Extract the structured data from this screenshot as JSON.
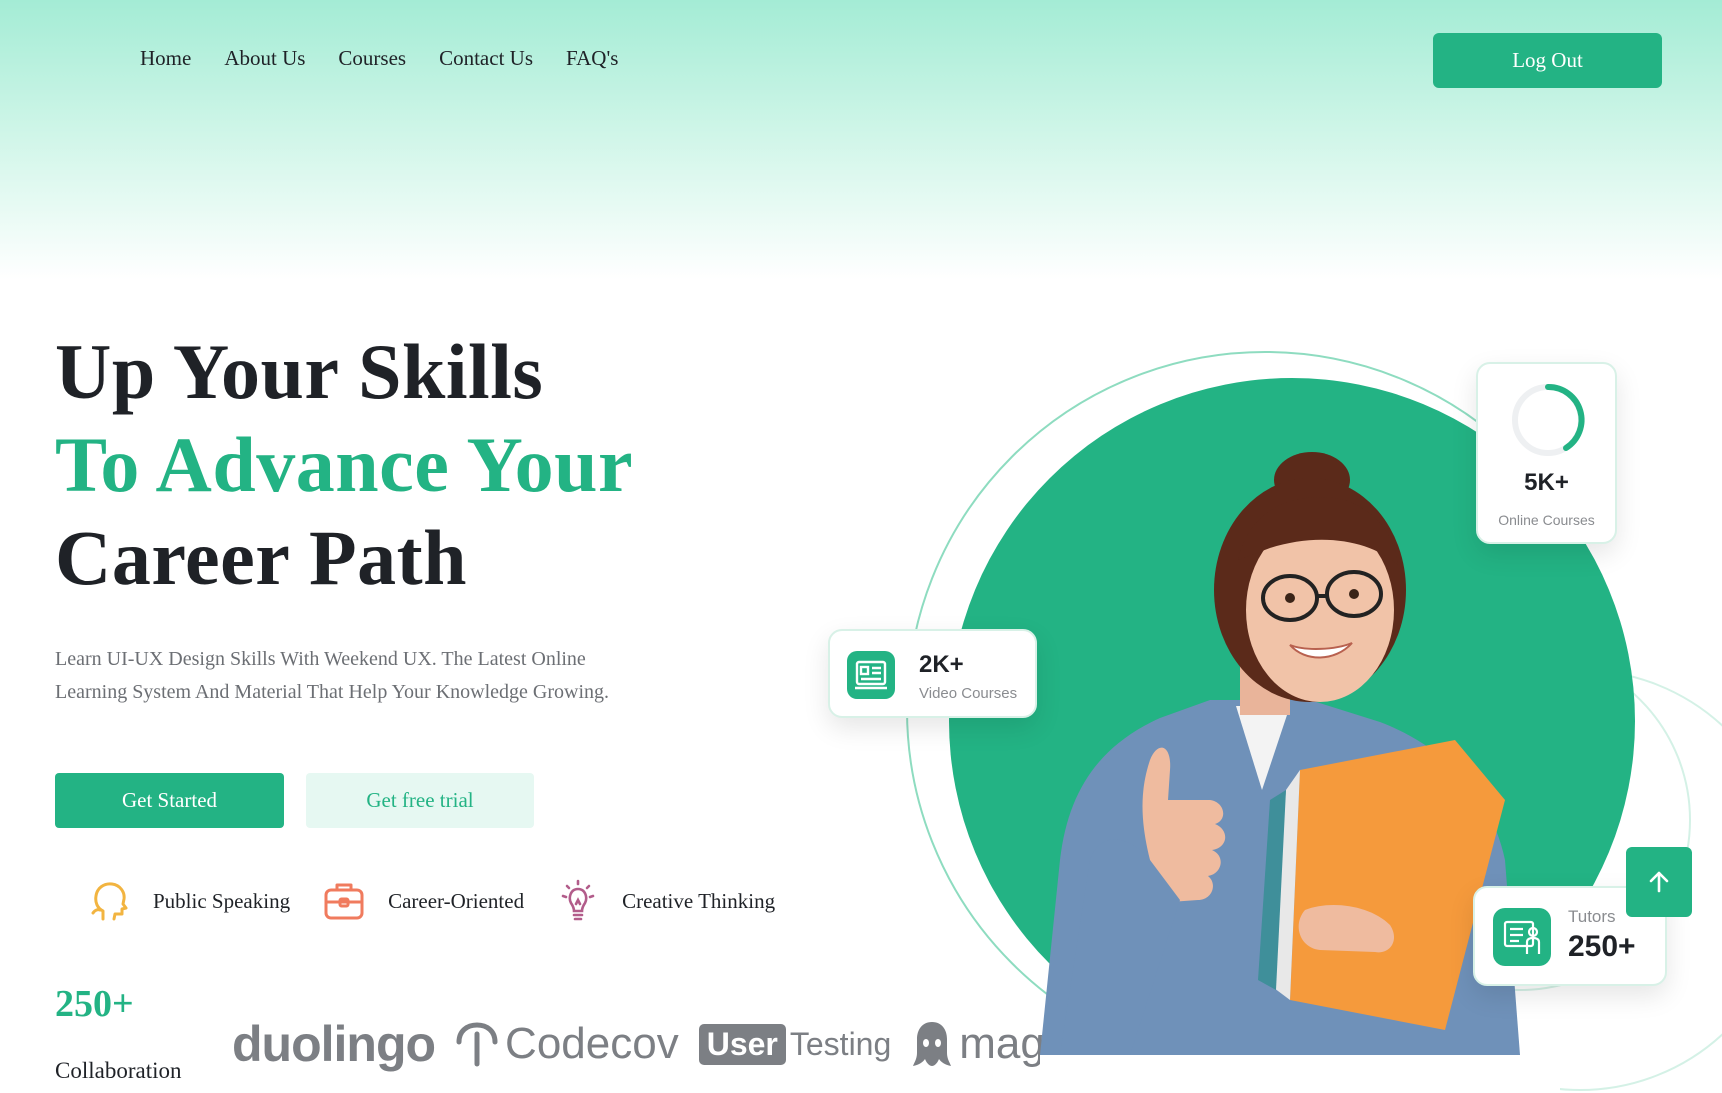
{
  "nav": {
    "links": [
      "Home",
      "About Us",
      "Courses",
      "Contact Us",
      "FAQ's"
    ],
    "logout_label": "Log Out"
  },
  "hero": {
    "title_line1": "Up Your Skills",
    "title_line2": "To Advance Your",
    "title_line3": "Career Path",
    "subtitle_line1": "Learn UI-UX Design Skills With Weekend UX. The Latest Online",
    "subtitle_line2": "Learning System And Material That Help Your Knowledge Growing.",
    "get_started_label": "Get Started",
    "free_trial_label": "Get free trial"
  },
  "features": [
    {
      "label": "Public Speaking",
      "icon": "speaking-head-icon",
      "color": "#f2b440"
    },
    {
      "label": "Career-Oriented",
      "icon": "briefcase-icon",
      "color": "#f07b5e"
    },
    {
      "label": "Creative Thinking",
      "icon": "lightbulb-icon",
      "color": "#b25c8a"
    }
  ],
  "collaboration": {
    "count": "250+",
    "label": "Collaboration",
    "logos": [
      "duolingo",
      "Codecov",
      "User",
      "Testing",
      "magic leap"
    ]
  },
  "stats": {
    "online_courses": {
      "value": "5K+",
      "label": "Online Courses"
    },
    "video_courses": {
      "value": "2K+",
      "label": "Video Courses"
    },
    "tutors": {
      "value": "250+",
      "label": "Tutors"
    }
  },
  "colors": {
    "accent": "#23b384",
    "dark_text": "#1f2227",
    "muted_text": "#6c6f74"
  }
}
